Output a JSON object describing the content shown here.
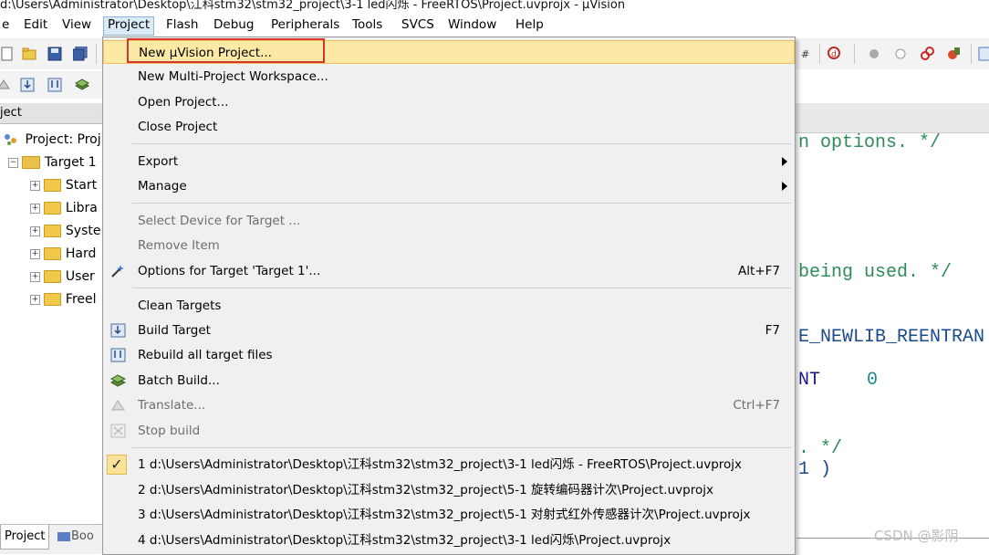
{
  "window": {
    "title": "d:\\Users\\Administrator\\Desktop\\江科stm32\\stm32_project\\3-1 led闪烁 - FreeRTOS\\Project.uvprojx - µVision"
  },
  "menubar": {
    "items": [
      "e",
      "Edit",
      "View",
      "Project",
      "Flash",
      "Debug",
      "Peripherals",
      "Tools",
      "SVCS",
      "Window",
      "Help"
    ]
  },
  "project_panel": {
    "header": "ject",
    "root": "Project: Proj",
    "target": "Target 1",
    "groups": [
      "Start",
      "Libra",
      "Syste",
      "Hard",
      "User",
      "Freel"
    ]
  },
  "bottom_tabs": {
    "project": "Project",
    "books": "Boo"
  },
  "editor": {
    "lines": [
      "n options. */",
      "being used. */",
      "E_NEWLIB_REENTRAN",
      "NT",
      "0",
      ". */",
      "1 )"
    ]
  },
  "project_menu": {
    "items": [
      {
        "label": "New µVision Project...",
        "shortcut": ""
      },
      {
        "label": "New Multi-Project Workspace...",
        "shortcut": ""
      },
      {
        "label": "Open Project...",
        "shortcut": ""
      },
      {
        "label": "Close Project",
        "shortcut": ""
      },
      {
        "label": "Export",
        "shortcut": ""
      },
      {
        "label": "Manage",
        "shortcut": ""
      },
      {
        "label": "Select Device for Target ...",
        "shortcut": ""
      },
      {
        "label": "Remove Item",
        "shortcut": ""
      },
      {
        "label": "Options for Target 'Target 1'...",
        "shortcut": "Alt+F7"
      },
      {
        "label": "Clean Targets",
        "shortcut": ""
      },
      {
        "label": "Build Target",
        "shortcut": "F7"
      },
      {
        "label": "Rebuild all target files",
        "shortcut": ""
      },
      {
        "label": "Batch Build...",
        "shortcut": ""
      },
      {
        "label": "Translate...",
        "shortcut": "Ctrl+F7"
      },
      {
        "label": "Stop build",
        "shortcut": ""
      }
    ],
    "recent": [
      "1 d:\\Users\\Administrator\\Desktop\\江科stm32\\stm32_project\\3-1 led闪烁 - FreeRTOS\\Project.uvprojx",
      "2 d:\\Users\\Administrator\\Desktop\\江科stm32\\stm32_project\\5-1 旋转编码器计次\\Project.uvprojx",
      "3 d:\\Users\\Administrator\\Desktop\\江科stm32\\stm32_project\\5-1 对射式红外传感器计次\\Project.uvprojx",
      "4 d:\\Users\\Administrator\\Desktop\\江科stm32\\stm32_project\\3-1 led闪烁\\Project.uvprojx"
    ]
  },
  "watermark": "CSDN @影阴",
  "colors": {
    "highlight": "#fde9a6",
    "highlight_border": "#f1c15f",
    "annotation": "#d8342f",
    "code_green": "#2e8b57",
    "code_teal": "#1a8a8a"
  }
}
